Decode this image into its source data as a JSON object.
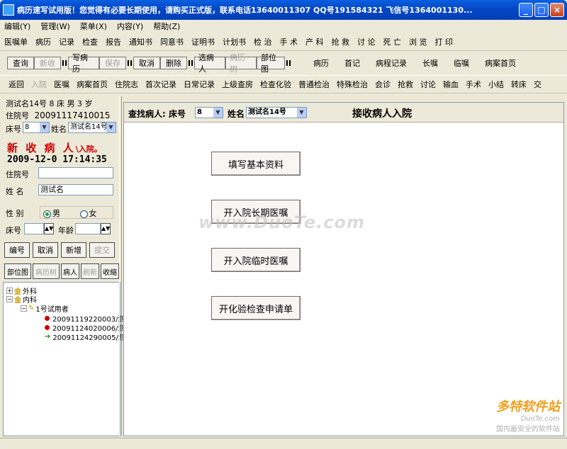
{
  "window": {
    "title": "病历速写试用版！您觉得有必要长期使用，请购买正式版，联系电话13640011307 QQ号191584321 飞信号1364001130...",
    "minimize": "_",
    "maximize": "□",
    "close": "×"
  },
  "menu": [
    "编辑(Y)",
    "管理(W)",
    "菜单(X)",
    "内容(Y)",
    "帮助(Z)"
  ],
  "toolbar1": [
    "医嘱单",
    "病历",
    "记录",
    "检查",
    "报告",
    "通知书",
    "同意书",
    "证明书",
    "计划书",
    "检 治",
    "手 术",
    "产 科",
    "抢 救",
    "讨 论",
    "死 亡",
    "浏 览",
    "打 印"
  ],
  "toolbar2": {
    "query": "查询",
    "add": "新收",
    "write": "写病历",
    "save": "保存",
    "cancel": "取消",
    "delete": "删除",
    "select_patient": "选病人",
    "history_tree": "病历树",
    "body_map": "部位图",
    "sep": "II",
    "links": [
      "病历",
      "首记",
      "病程记录",
      "长嘱",
      "临嘱",
      "病案首页"
    ]
  },
  "toolbar3": [
    "返回",
    "入院",
    "医嘱",
    "病案首页",
    "住院志",
    "首次记录",
    "日常记录",
    "上级查房",
    "检查化验",
    "普通检治",
    "特殊检治",
    "会诊",
    "抢救",
    "讨论",
    "输血",
    "手术",
    "小结",
    "转床",
    "交"
  ],
  "patient": {
    "summary": "测试名14号  8 床 男  3 岁",
    "admission_label": "住院号",
    "admission_no": "20091117410015",
    "bed_label": "床号",
    "bed": "8",
    "name_label": "姓名",
    "name": "测试名14号"
  },
  "new_patient": {
    "heading": "新 收 病 人",
    "heading_tail": "\\入院。",
    "datetime": "2009-12-0 17:14:35",
    "admission_label": "住院号",
    "admission_value": "",
    "name_label": "姓  名",
    "name_value": "测试名",
    "gender_label": "性  别",
    "male": "男",
    "female": "女",
    "bed_label": "床号",
    "age_label": "年龄"
  },
  "left_buttons": {
    "number": "编号",
    "cancel": "取消",
    "add": "新增",
    "submit": "提交"
  },
  "left_tabs": {
    "body_map": "部位图",
    "history_tree": "病历树",
    "patient": "病人",
    "refresh": "刷新",
    "collapse": "收缩"
  },
  "tree": {
    "surgery": "外科",
    "internal": "内科",
    "trial_user": "1号试用者",
    "records": [
      "20091119220003/测",
      "20091124020006/测",
      "20091124290005/测"
    ]
  },
  "main": {
    "find_label": "查找病人: 床号",
    "bed": "8",
    "name_label": "姓名",
    "name": "测试名14号",
    "title": "接收病人入院",
    "buttons": [
      "填写基本资料",
      "开入院长期医嘱",
      "开入院临时医嘱",
      "开化验检查申请单"
    ]
  },
  "watermark": "www.DuoTe.com",
  "brand": {
    "name": "多特软件站",
    "url": "DuoTe.com",
    "tagline": "国内最安全的软件站"
  }
}
